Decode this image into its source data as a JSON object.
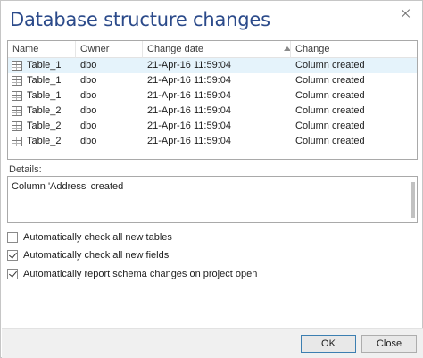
{
  "dialog": {
    "title": "Database structure changes"
  },
  "grid": {
    "columns": {
      "name": "Name",
      "owner": "Owner",
      "change_date": "Change date",
      "change": "Change"
    },
    "rows": [
      {
        "name": "Table_1",
        "owner": "dbo",
        "change_date": "21-Apr-16 11:59:04",
        "change": "Column created"
      },
      {
        "name": "Table_1",
        "owner": "dbo",
        "change_date": "21-Apr-16 11:59:04",
        "change": "Column created"
      },
      {
        "name": "Table_1",
        "owner": "dbo",
        "change_date": "21-Apr-16 11:59:04",
        "change": "Column created"
      },
      {
        "name": "Table_2",
        "owner": "dbo",
        "change_date": "21-Apr-16 11:59:04",
        "change": "Column created"
      },
      {
        "name": "Table_2",
        "owner": "dbo",
        "change_date": "21-Apr-16 11:59:04",
        "change": "Column created"
      },
      {
        "name": "Table_2",
        "owner": "dbo",
        "change_date": "21-Apr-16 11:59:04",
        "change": "Column created"
      }
    ]
  },
  "details": {
    "label": "Details:",
    "text": "Column 'Address' created"
  },
  "options": {
    "check_new_tables": {
      "label": "Automatically check all new tables",
      "checked": false
    },
    "check_new_fields": {
      "label": "Automatically check all new fields",
      "checked": true
    },
    "report_on_open": {
      "label": "Automatically report schema changes on project open",
      "checked": true
    }
  },
  "buttons": {
    "ok": "OK",
    "close": "Close"
  }
}
